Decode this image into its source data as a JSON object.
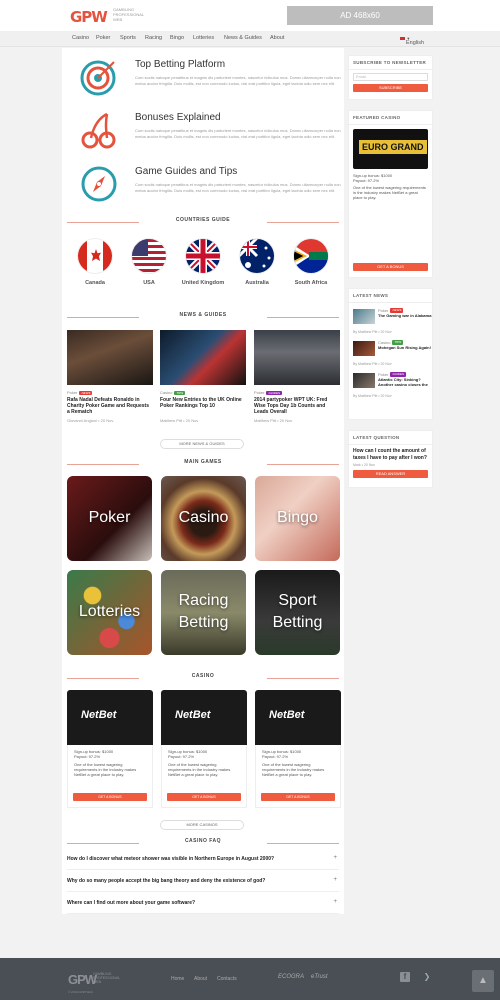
{
  "header": {
    "logo": "GPW",
    "logo_sub": "Gambling Professional Web",
    "ad": "AD 468x60"
  },
  "nav": {
    "items": [
      "Casino",
      "Poker",
      "Sports",
      "Racing",
      "Bingo",
      "Lotteries",
      "News & Guides",
      "About"
    ],
    "language": "English"
  },
  "features": [
    {
      "title": "Top Betting Platform",
      "text": "Cum sociis natoque penatibus et magnis dis parturient montes, nascetur ridiculus mus. Donec ullamcorper nulla non metus auctor fringilla. Duis mollis, est non commodo luctus, nisi erat porttitor ligula, eget lacinia odio sem nec elit.",
      "icon": "target-icon"
    },
    {
      "title": "Bonuses Explained",
      "text": "Cum sociis natoque penatibus et magnis dis parturient montes, nascetur ridiculus mus. Donec ullamcorper nulla non metus auctor fringilla. Duis mollis, est non commodo luctus, nisi erat porttitor ligula, eget lacinia odio sem nec elit.",
      "icon": "cherries-icon"
    },
    {
      "title": "Game Guides and Tips",
      "text": "Cum sociis natoque penatibus et magnis dis parturient montes, nascetur ridiculus mus. Donec ullamcorper nulla non metus auctor fringilla. Duis mollis, est non commodo luctus, nisi erat porttitor ligula, eget lacinia odio sem nec elit.",
      "icon": "compass-icon"
    }
  ],
  "countries": {
    "title": "COUNTRIES GUIDE",
    "items": [
      "Canada",
      "USA",
      "United Kingdom",
      "Australia",
      "South Africa"
    ]
  },
  "news": {
    "title": "NEWS & GUIDES",
    "more": "MORE NEWS & GUIDES",
    "items": [
      {
        "category": "Poker",
        "badge": "NEWS",
        "badge_color": "#e53935",
        "title": "Rafa Nadal Defeats Ronaldo in Charity Poker Game and Requests a Rematch",
        "meta": "Giovanni Angioni • 20 Nov"
      },
      {
        "category": "Casino",
        "badge": "TIPS",
        "badge_color": "#43a047",
        "title": "Four New Entries to the UK Online Poker Rankings Top 10",
        "meta": "Matthew Pitt • 20 Nov"
      },
      {
        "category": "Poker",
        "badge": "GUIDES",
        "badge_color": "#8e24aa",
        "title": "2014 partypoker WPT UK: Fred Wise Tops Day 1b Counts and Leads Overall",
        "meta": "Matthew Pitt • 20 Nov"
      }
    ]
  },
  "games": {
    "title": "MAIN GAMES",
    "items": [
      "Poker",
      "Casino",
      "Bingo",
      "Lotteries",
      "Racing Betting",
      "Sport Betting"
    ]
  },
  "casinos": {
    "title": "CASINO",
    "more": "MORE CASINOS",
    "items": [
      {
        "logo": "NetBet",
        "bonus": "Sign-up bonus: $1000",
        "payout": "Payout: 97.2%",
        "desc": "One of the lowest wagering requirements in the industry makes NetBet a great place to play.",
        "btn": "GET A BONUS"
      },
      {
        "logo": "NetBet",
        "bonus": "Sign-up bonus: $1000",
        "payout": "Payout: 97.2%",
        "desc": "One of the lowest wagering requirements in the industry makes NetBet a great place to play.",
        "btn": "GET A BONUS"
      },
      {
        "logo": "NetBet",
        "bonus": "Sign-up bonus: $1000",
        "payout": "Payout: 97.2%",
        "desc": "One of the lowest wagering requirements in the industry makes NetBet a great place to play.",
        "btn": "GET A BONUS"
      }
    ]
  },
  "faq": {
    "title": "CASINO FAQ",
    "items": [
      "How do I discover what meteor shower was visible in Northern Europe in August 2000?",
      "Why do so many people accept the big bang theory and deny the existence of god?",
      "Where can I find out more about your game software?"
    ]
  },
  "sidebar": {
    "newsletter": {
      "title": "SUBSCRIBE TO NEWSLETTER",
      "placeholder": "Email",
      "btn": "SUBSCRIBE"
    },
    "featured": {
      "title": "FEATURED CASINO",
      "logo": "EURO GRAND",
      "bonus": "Sign-up bonus: $1000",
      "payout": "Payout: 97.2%",
      "desc": "One of the lowest wagering requirements in the industry makes NetBet a great place to play.",
      "btn": "GET A BONUS"
    },
    "latest_news": {
      "title": "LATEST NEWS",
      "items": [
        {
          "category": "Poker",
          "badge": "NEWS",
          "badge_color": "#e53935",
          "title": "The Gaming war in Alabama",
          "meta": "By Matthew Pitt • 20 Nov"
        },
        {
          "category": "Casino",
          "badge": "TIPS",
          "badge_color": "#43a047",
          "title": "Mohegan Sun Rising Again!",
          "meta": "By Matthew Pitt • 20 Nov"
        },
        {
          "category": "Poker",
          "badge": "GUIDES",
          "badge_color": "#8e24aa",
          "title": "Atlantic City: Sinking? Another casino closes the",
          "meta": "By Matthew Pitt • 20 Nov"
        }
      ]
    },
    "latest_question": {
      "title": "LATEST QUESTION",
      "text": "How can I count the amount of taxes I have to pay after I won?",
      "meta": "Mark • 20 Nov",
      "btn": "READ ANSWER"
    }
  },
  "footer": {
    "logo": "GPW",
    "logo_sub": "Gambling Professional Web",
    "links": [
      "Home",
      "About",
      "Contacts"
    ],
    "badges": [
      "ECOGRA",
      "eTrust"
    ],
    "copyright": "© 2014 GPW Web"
  }
}
